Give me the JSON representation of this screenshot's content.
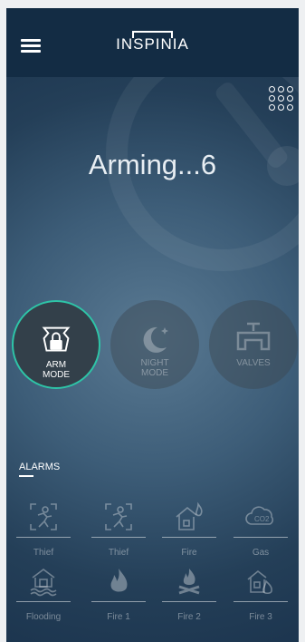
{
  "header": {
    "logo_text": "INSPINIA",
    "menu_icon": "hamburger-icon"
  },
  "status_text": "Arming...6",
  "modes": [
    {
      "label": "ARM\nMODE",
      "icon": "alarm-lock-icon",
      "active": true
    },
    {
      "label": "NIGHT\nMODE",
      "icon": "moon-icon",
      "active": false
    },
    {
      "label": "VALVES",
      "icon": "valve-icon",
      "active": false
    }
  ],
  "alarms_title": "ALARMS",
  "alarms": [
    {
      "label": "Thief",
      "icon": "thief-icon"
    },
    {
      "label": "Thief",
      "icon": "thief-icon"
    },
    {
      "label": "Fire",
      "icon": "house-fire-icon"
    },
    {
      "label": "Gas",
      "icon": "co2-icon"
    },
    {
      "label": "Flooding",
      "icon": "flood-icon"
    },
    {
      "label": "Fire 1",
      "icon": "flame-icon"
    },
    {
      "label": "Fire 2",
      "icon": "campfire-icon"
    },
    {
      "label": "Fire 3",
      "icon": "house-fire-icon"
    }
  ],
  "colors": {
    "accent": "#2ec4a7",
    "header_bg": "#132c44"
  }
}
